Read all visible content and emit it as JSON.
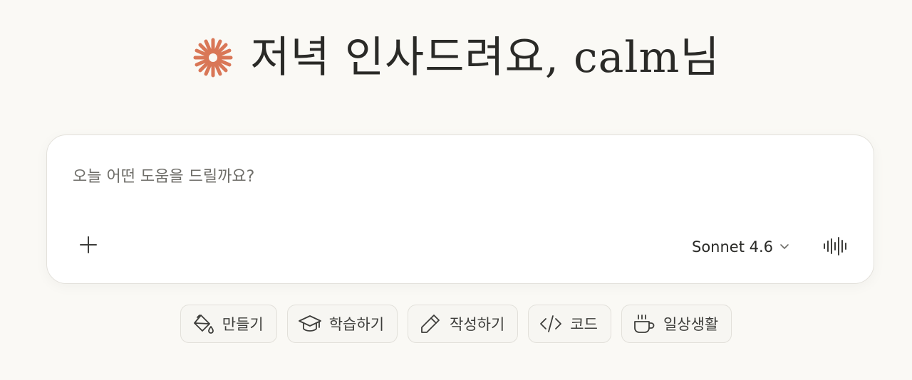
{
  "greeting": {
    "text": "저녁 인사드려요, calm님",
    "icon": "sparkle-icon",
    "icon_color": "#d97757"
  },
  "composer": {
    "placeholder": "오늘 어떤 도움을 드릴까요?",
    "add_icon": "plus-icon",
    "model_label": "Sonnet 4.6",
    "model_icon": "chevron-down-icon",
    "voice_icon": "audio-waveform-icon"
  },
  "chips": [
    {
      "label": "만들기",
      "icon": "paint-bucket-icon"
    },
    {
      "label": "학습하기",
      "icon": "graduation-cap-icon"
    },
    {
      "label": "작성하기",
      "icon": "pencil-icon"
    },
    {
      "label": "코드",
      "icon": "code-icon"
    },
    {
      "label": "일상생활",
      "icon": "coffee-cup-icon"
    }
  ]
}
